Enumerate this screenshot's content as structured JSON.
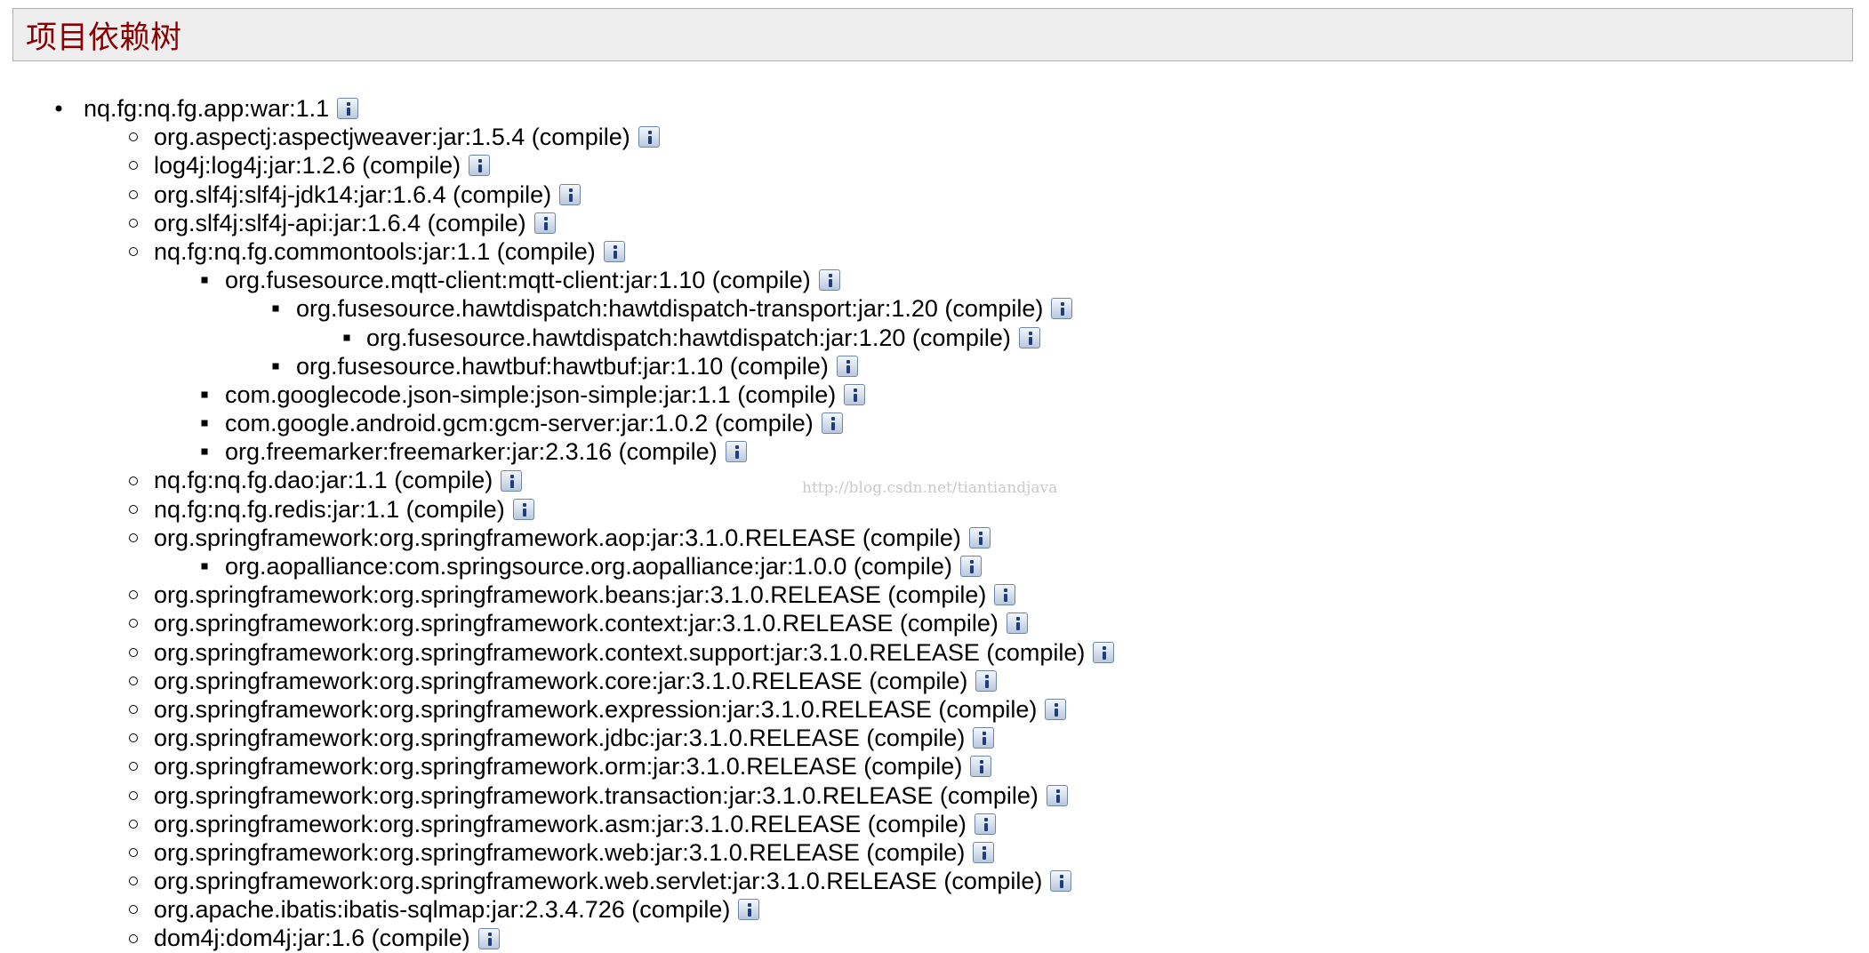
{
  "header": {
    "title": "项目依赖树"
  },
  "watermark": "http://blog.csdn.net/tiantiandjava",
  "tree": [
    {
      "label": "nq.fg:nq.fg.app:war:1.1",
      "depth": 0
    },
    {
      "label": "org.aspectj:aspectjweaver:jar:1.5.4 (compile)",
      "depth": 1
    },
    {
      "label": "log4j:log4j:jar:1.2.6 (compile)",
      "depth": 1
    },
    {
      "label": "org.slf4j:slf4j-jdk14:jar:1.6.4 (compile)",
      "depth": 1
    },
    {
      "label": "org.slf4j:slf4j-api:jar:1.6.4 (compile)",
      "depth": 1
    },
    {
      "label": "nq.fg:nq.fg.commontools:jar:1.1 (compile)",
      "depth": 1
    },
    {
      "label": "org.fusesource.mqtt-client:mqtt-client:jar:1.10 (compile)",
      "depth": 2
    },
    {
      "label": "org.fusesource.hawtdispatch:hawtdispatch-transport:jar:1.20 (compile)",
      "depth": 3
    },
    {
      "label": "org.fusesource.hawtdispatch:hawtdispatch:jar:1.20 (compile)",
      "depth": 4
    },
    {
      "label": "org.fusesource.hawtbuf:hawtbuf:jar:1.10 (compile)",
      "depth": 3
    },
    {
      "label": "com.googlecode.json-simple:json-simple:jar:1.1 (compile)",
      "depth": 2
    },
    {
      "label": "com.google.android.gcm:gcm-server:jar:1.0.2 (compile)",
      "depth": 2
    },
    {
      "label": "org.freemarker:freemarker:jar:2.3.16 (compile)",
      "depth": 2
    },
    {
      "label": "nq.fg:nq.fg.dao:jar:1.1 (compile)",
      "depth": 1
    },
    {
      "label": "nq.fg:nq.fg.redis:jar:1.1 (compile)",
      "depth": 1
    },
    {
      "label": "org.springframework:org.springframework.aop:jar:3.1.0.RELEASE (compile)",
      "depth": 1
    },
    {
      "label": "org.aopalliance:com.springsource.org.aopalliance:jar:1.0.0 (compile)",
      "depth": 2
    },
    {
      "label": "org.springframework:org.springframework.beans:jar:3.1.0.RELEASE (compile)",
      "depth": 1
    },
    {
      "label": "org.springframework:org.springframework.context:jar:3.1.0.RELEASE (compile)",
      "depth": 1
    },
    {
      "label": "org.springframework:org.springframework.context.support:jar:3.1.0.RELEASE (compile)",
      "depth": 1
    },
    {
      "label": "org.springframework:org.springframework.core:jar:3.1.0.RELEASE (compile)",
      "depth": 1
    },
    {
      "label": "org.springframework:org.springframework.expression:jar:3.1.0.RELEASE (compile)",
      "depth": 1
    },
    {
      "label": "org.springframework:org.springframework.jdbc:jar:3.1.0.RELEASE (compile)",
      "depth": 1
    },
    {
      "label": "org.springframework:org.springframework.orm:jar:3.1.0.RELEASE (compile)",
      "depth": 1
    },
    {
      "label": "org.springframework:org.springframework.transaction:jar:3.1.0.RELEASE (compile)",
      "depth": 1
    },
    {
      "label": "org.springframework:org.springframework.asm:jar:3.1.0.RELEASE (compile)",
      "depth": 1
    },
    {
      "label": "org.springframework:org.springframework.web:jar:3.1.0.RELEASE (compile)",
      "depth": 1
    },
    {
      "label": "org.springframework:org.springframework.web.servlet:jar:3.1.0.RELEASE (compile)",
      "depth": 1
    },
    {
      "label": "org.apache.ibatis:ibatis-sqlmap:jar:2.3.4.726 (compile)",
      "depth": 1
    },
    {
      "label": "dom4j:dom4j:jar:1.6 (compile)",
      "depth": 1
    }
  ],
  "icons": {
    "info": "info-icon"
  },
  "colors": {
    "header_title": "#8b0000",
    "header_bg": "#eeeeee",
    "info_icon": "#1f3d7a"
  }
}
